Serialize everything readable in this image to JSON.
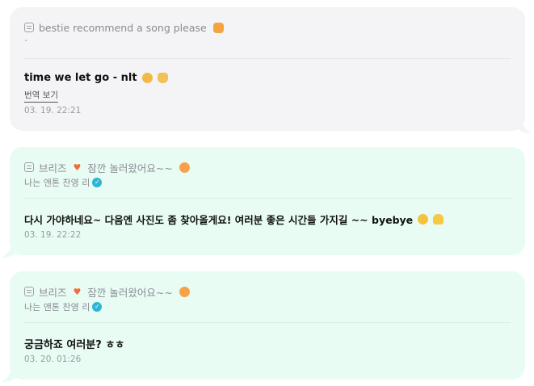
{
  "comments": [
    {
      "quote": "bestie recommend a song please",
      "quote_emoji": "cat-emoji",
      "extra_dot": ".",
      "body": "time we let go - nlt",
      "body_emojis": [
        "partying-face-emoji",
        "call-me-hand-emoji"
      ],
      "translate_label": "번역 보기",
      "timestamp": "03. 19. 22:21"
    },
    {
      "quote_prefix": "브리즈",
      "quote_suffix": "잠깐 놀러왔어요~~",
      "quote_emoji": "face-emoji",
      "author": "나는 앤톤 찬영 리",
      "body": "다시 가야하네요~ 다음엔 사진도 좀 찾아올게요! 여러분 좋은 시간들 가지길 ~~ byebye",
      "body_emojis": [
        "smiling-face-emoji",
        "heart-hands-emoji"
      ],
      "timestamp": "03. 19. 22:22"
    },
    {
      "quote_prefix": "브리즈",
      "quote_suffix": "잠깐 놀러왔어요~~",
      "quote_emoji": "face-emoji",
      "author": "나는 앤톤 찬영 리",
      "body": "궁금하죠 여러분? ㅎㅎ",
      "timestamp": "03. 20. 01:26"
    }
  ],
  "colors": {
    "card_gray": "#f4f4f6",
    "card_mint": "#e8fcf4",
    "heart": "#f26b3a",
    "verified": "#2cb6d4"
  }
}
